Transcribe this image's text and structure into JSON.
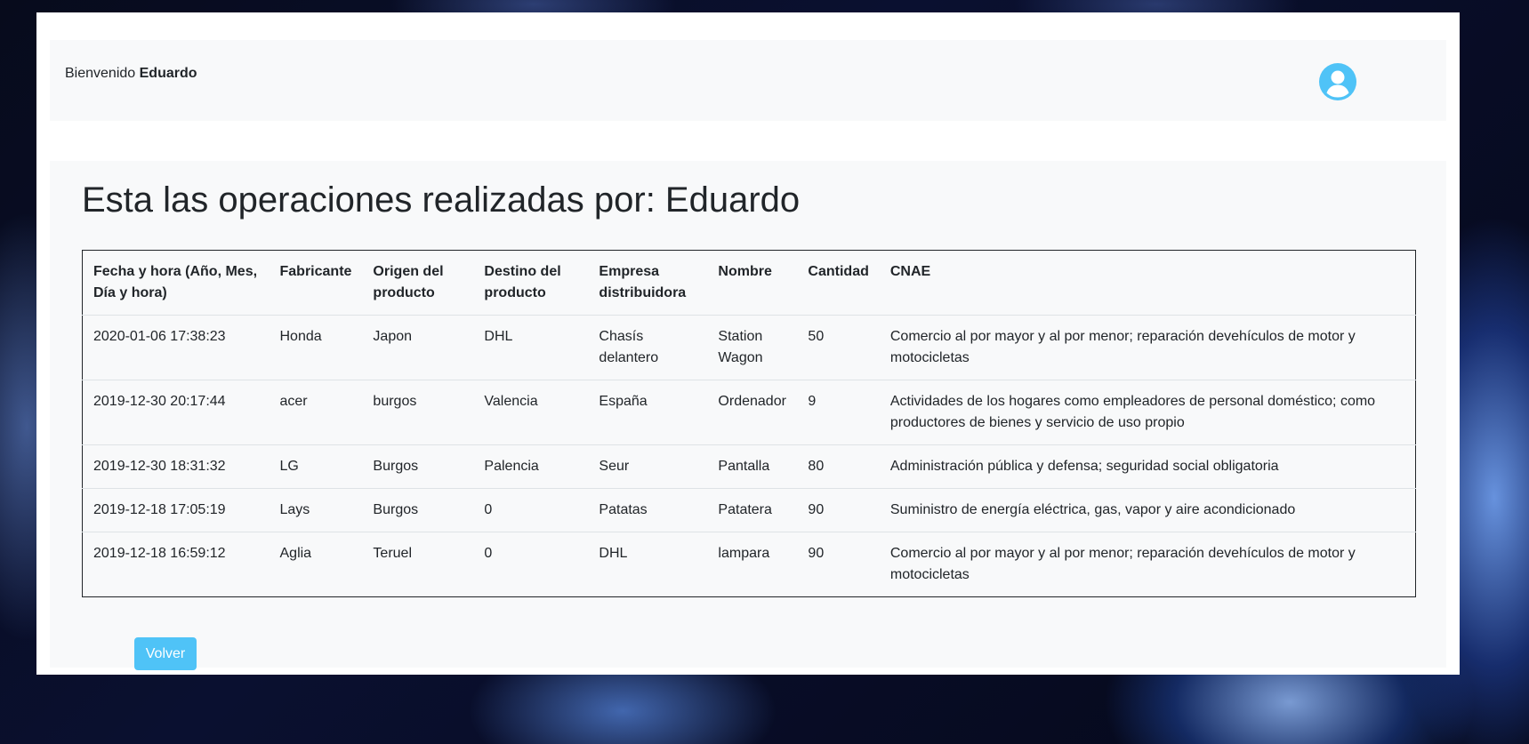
{
  "header": {
    "welcome_prefix": "Bienvenido ",
    "username": "Eduardo",
    "avatar_icon": "user-circle-icon",
    "accent_color": "#4fc3f7"
  },
  "main": {
    "title": "Esta las operaciones realizadas por: Eduardo",
    "table": {
      "headers": [
        "Fecha y hora (Año, Mes, Día y hora)",
        "Fabricante",
        "Origen del producto",
        "Destino del producto",
        "Empresa distribuidora",
        "Nombre",
        "Cantidad",
        "CNAE"
      ],
      "rows": [
        [
          "2020-01-06 17:38:23",
          "Honda",
          "Japon",
          "DHL",
          "Chasís delantero",
          "Station Wagon",
          "50",
          "Comercio al por mayor y al por menor; reparación devehículos de motor y motocicletas"
        ],
        [
          "2019-12-30 20:17:44",
          "acer",
          "burgos",
          "Valencia",
          "España",
          "Ordenador",
          "9",
          "Actividades de los hogares como empleadores de personal doméstico; como productores de bienes y servicio de uso propio"
        ],
        [
          "2019-12-30 18:31:32",
          "LG",
          "Burgos",
          "Palencia",
          "Seur",
          "Pantalla",
          "80",
          "Administración pública y defensa; seguridad social obligatoria"
        ],
        [
          "2019-12-18 17:05:19",
          "Lays",
          "Burgos",
          "0",
          "Patatas",
          "Patatera",
          "90",
          "Suministro de energía eléctrica, gas, vapor y aire acondicionado"
        ],
        [
          "2019-12-18 16:59:12",
          "Aglia",
          "Teruel",
          "0",
          "DHL",
          "lampara",
          "90",
          "Comercio al por mayor y al por menor; reparación devehículos de motor y motocicletas"
        ]
      ]
    },
    "back_button": "Volver"
  }
}
